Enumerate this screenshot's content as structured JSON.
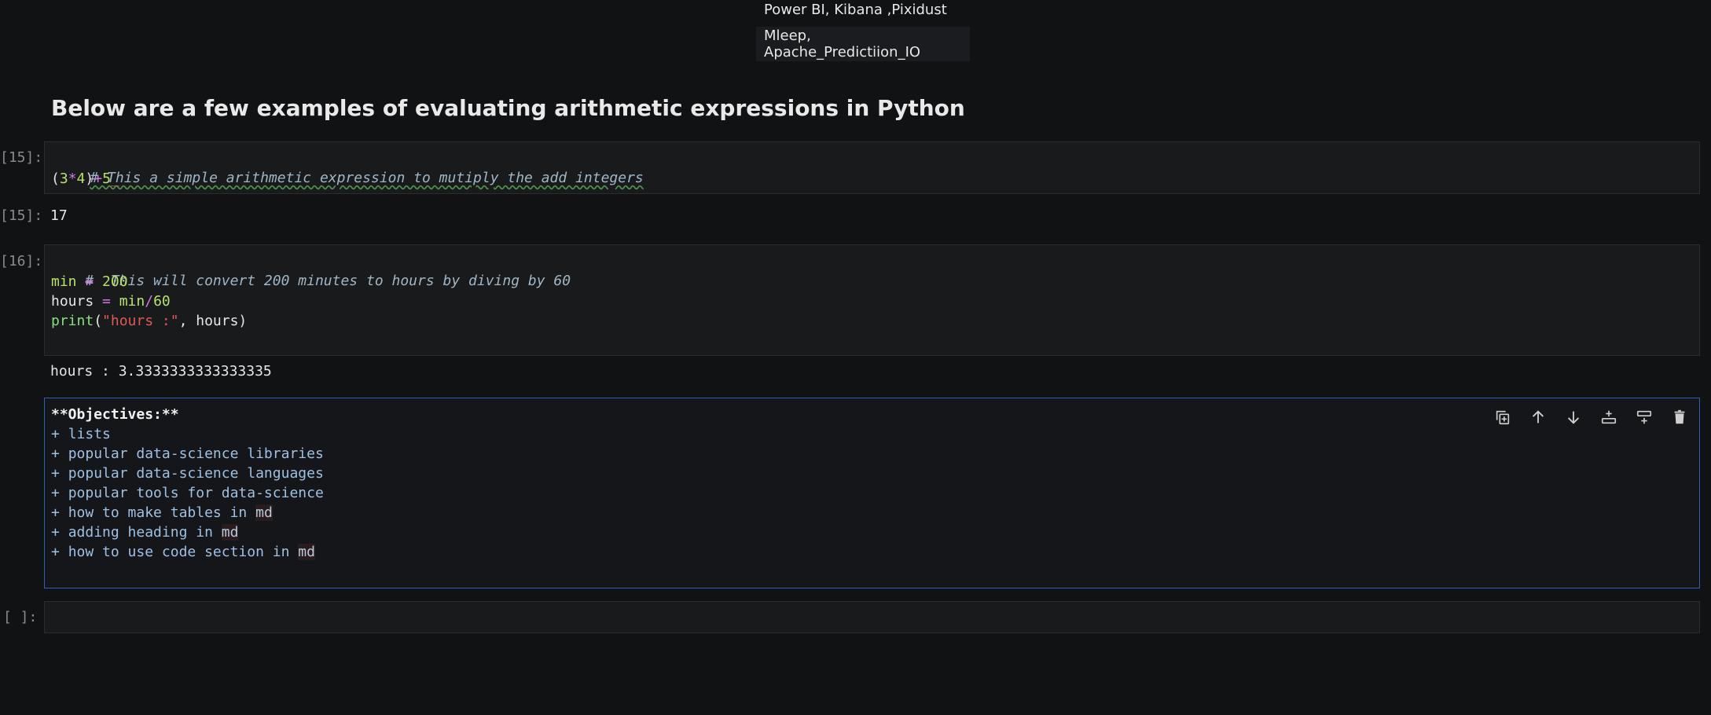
{
  "top_table": {
    "row_a": "Power BI, Kibana ,Pixidust",
    "row_b": "Mleep, Apache_Predictiion_IO"
  },
  "heading": "Below are a few examples of evaluating arithmetic expressions in Python",
  "cell1": {
    "in_prompt": "[15]:",
    "comment": "# This a simple arithmetic expression to mutiply the add integers",
    "code": {
      "p1": "(",
      "n1": "3",
      "op1": "*",
      "n2": "4",
      "p2": ")",
      "op2": "+",
      "n3": "5",
      "cursor": "_"
    },
    "out_prompt": "[15]:",
    "output": "17"
  },
  "cell2": {
    "in_prompt": "[16]:",
    "comment": "#  This will convert 200 minutes to hours by diving by 60",
    "line2": {
      "var": "min",
      "eq": " = ",
      "val": "200"
    },
    "line3": {
      "var": "hours",
      "eq": " = ",
      "v2": "min",
      "op": "/",
      "val": "60"
    },
    "line4": {
      "fn": "print",
      "open": "(",
      "str": "\"hours :\"",
      "rest": ", hours)"
    },
    "output": "hours : 3.3333333333333335"
  },
  "markdown_cell": {
    "title": "**Objectives:**",
    "items": [
      {
        "prefix": "+ ",
        "text": "lists",
        "md": ""
      },
      {
        "prefix": "+ ",
        "text": "popular data-science libraries",
        "md": ""
      },
      {
        "prefix": "+ ",
        "text": "popular data-science languages",
        "md": ""
      },
      {
        "prefix": "+ ",
        "text": "popular tools for data-science",
        "md": ""
      },
      {
        "prefix": "+ ",
        "text": "how to make tables in ",
        "md": "md"
      },
      {
        "prefix": "+ ",
        "text": "adding heading in ",
        "md": "md"
      },
      {
        "prefix": "+ ",
        "text": "how to use code section in ",
        "md": "md"
      }
    ]
  },
  "toolbar": {
    "icons": [
      "duplicate-icon",
      "move-up-icon",
      "move-down-icon",
      "insert-below-icon",
      "insert-above-icon",
      "delete-icon"
    ]
  },
  "empty_cell": {
    "in_prompt": "[ ]:"
  }
}
